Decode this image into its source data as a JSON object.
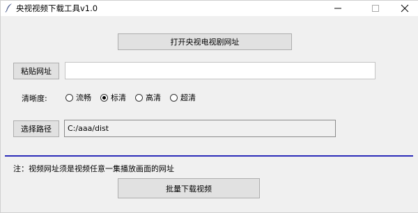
{
  "window": {
    "title": "央视视频下载工具v1.0"
  },
  "buttons": {
    "open_site": "打开央视电视剧网址",
    "paste_url": "粘贴网址",
    "choose_path": "选择路径",
    "batch_download": "批量下载视频"
  },
  "inputs": {
    "url_value": "",
    "path_value": "C:/aaa/dist"
  },
  "resolution": {
    "label": "清晰度:",
    "options": [
      {
        "label": "流畅",
        "checked": false
      },
      {
        "label": "标清",
        "checked": true
      },
      {
        "label": "高清",
        "checked": false
      },
      {
        "label": "超清",
        "checked": false
      }
    ]
  },
  "note": "注：视频网址须是视频任意一集播放画面的网址",
  "colors": {
    "divider": "#2a2ab8"
  },
  "icons": {
    "app": "feather-icon",
    "minimize": "minimize-icon",
    "maximize": "maximize-icon",
    "close": "close-icon"
  }
}
